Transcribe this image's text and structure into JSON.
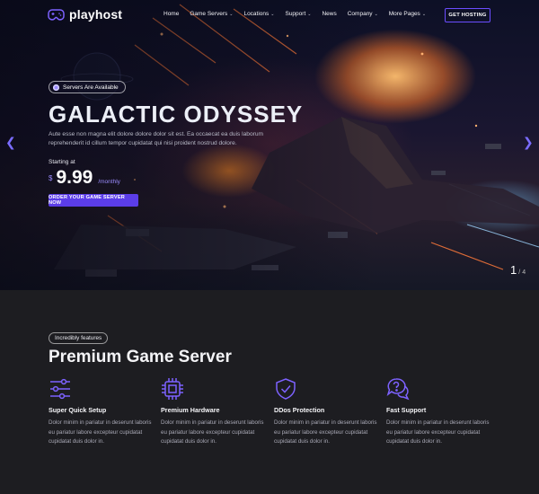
{
  "brand": {
    "name": "playhost",
    "accent": "#6b4dff"
  },
  "nav": {
    "items": [
      {
        "label": "Home",
        "dropdown": false
      },
      {
        "label": "Game Servers",
        "dropdown": true
      },
      {
        "label": "Locations",
        "dropdown": true
      },
      {
        "label": "Support",
        "dropdown": true
      },
      {
        "label": "News",
        "dropdown": false
      },
      {
        "label": "Company",
        "dropdown": true
      },
      {
        "label": "More Pages",
        "dropdown": true
      }
    ],
    "cta": "GET HOSTING"
  },
  "hero": {
    "badge": "Servers Are Available",
    "title": "GALACTIC ODYSSEY",
    "description": "Aute esse non magna elit dolore dolore dolor sit est. Ea occaecat ea duis laborum reprehenderit id cillum tempor cupidatat qui nisi proident nostrud dolore.",
    "starting_label": "Starting at",
    "currency": "$",
    "price": "9.99",
    "period": "/monthly",
    "order_button": "ORDER YOUR GAME SERVER NOW",
    "slide_current": "1",
    "slide_separator": "/",
    "slide_total": "4"
  },
  "features": {
    "badge": "Incredibly features",
    "title": "Premium Game Server",
    "items": [
      {
        "icon": "sliders-icon",
        "title": "Super Quick Setup",
        "text": "Dolor minim in pariatur in deserunt laboris eu pariatur labore excepteur cupidatat cupidatat duis dolor in."
      },
      {
        "icon": "cpu-chip-icon",
        "title": "Premium Hardware",
        "text": "Dolor minim in pariatur in deserunt laboris eu pariatur labore excepteur cupidatat cupidatat duis dolor in."
      },
      {
        "icon": "shield-check-icon",
        "title": "DDos Protection",
        "text": "Dolor minim in pariatur in deserunt laboris eu pariatur labore excepteur cupidatat cupidatat duis dolor in."
      },
      {
        "icon": "chat-question-icon",
        "title": "Fast Support",
        "text": "Dolor minim in pariatur in deserunt laboris eu pariatur labore excepteur cupidatat cupidatat duis dolor in."
      }
    ]
  }
}
